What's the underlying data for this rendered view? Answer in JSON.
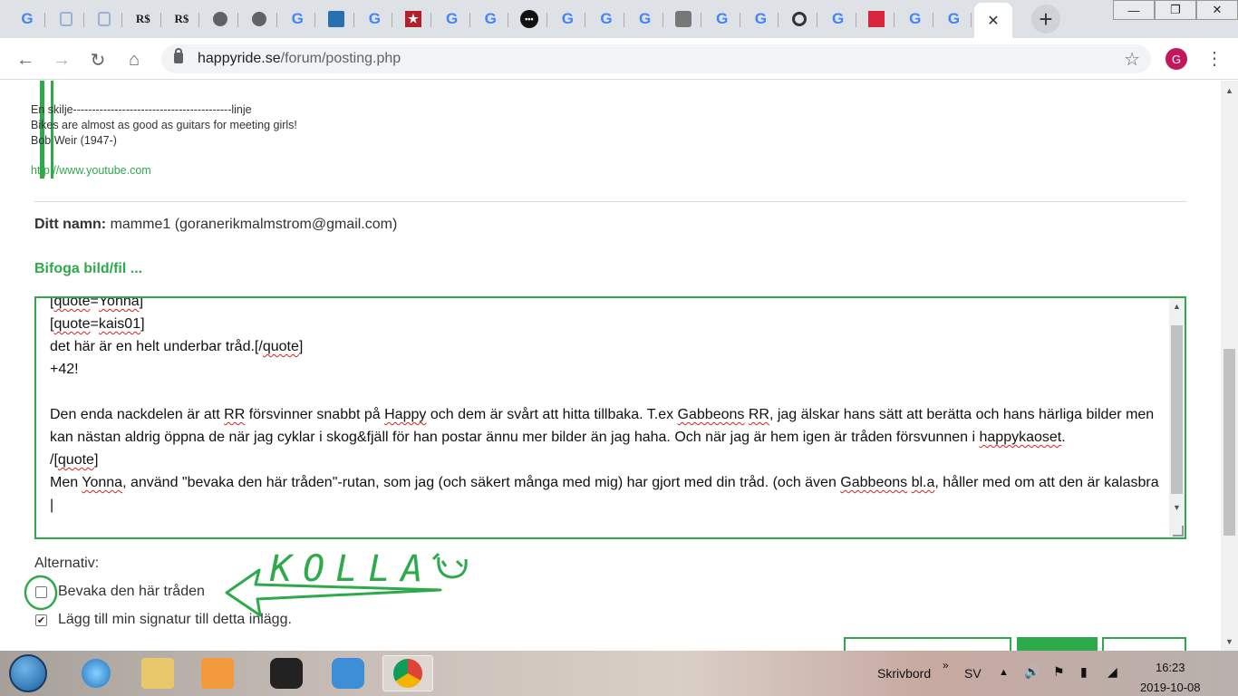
{
  "browser": {
    "tabs_count": 26,
    "new_tab_symbol": "+",
    "window_buttons": [
      "—",
      "❐",
      "✕"
    ],
    "url_host": "happyride.se",
    "url_path": "/forum/posting.php",
    "profile_initial": "G"
  },
  "signature": {
    "lines": [
      "En skilje------------------------------------------linje",
      "Bikes are almost as good as guitars for meeting girls!",
      "Bob Weir (1947-)"
    ],
    "link": "http://www.youtube.com"
  },
  "poster": {
    "label": "Ditt namn:",
    "value": "mamme1 (goranerikmalmstrom@gmail.com)"
  },
  "attach_label": "Bifoga bild/fil ...",
  "editor": {
    "paragraphs": [
      [
        {
          "t": "["
        },
        {
          "t": "quote",
          "sp": true
        },
        {
          "t": "="
        },
        {
          "t": "Yonna",
          "sp": true
        },
        {
          "t": "]"
        }
      ],
      [
        {
          "t": "["
        },
        {
          "t": "quote",
          "sp": true
        },
        {
          "t": "="
        },
        {
          "t": "kais01",
          "sp": true
        },
        {
          "t": "]"
        }
      ],
      [
        {
          "t": "det här är en helt underbar tråd.[/"
        },
        {
          "t": "quote",
          "sp": true
        },
        {
          "t": "]"
        }
      ],
      [
        {
          "t": "+42!"
        }
      ],
      [
        {
          "t": ""
        }
      ],
      [
        {
          "t": "Den enda nackdelen är att "
        },
        {
          "t": "RR",
          "sp": true
        },
        {
          "t": " försvinner snabbt på "
        },
        {
          "t": "Happy",
          "sp": true
        },
        {
          "t": " och dem är svårt att hitta tillbaka. T.ex "
        },
        {
          "t": "Gabbeons",
          "sp": true
        },
        {
          "t": " "
        },
        {
          "t": "RR",
          "sp": true
        },
        {
          "t": ", jag älskar hans sätt att berätta och hans härliga bilder men kan nästan aldrig öppna de när jag cyklar i skog&fjäll för han postar ännu mer bilder än jag haha. Och när jag är hem igen är tråden försvunnen i "
        },
        {
          "t": "happykaoset",
          "sp": true
        },
        {
          "t": "."
        }
      ],
      [
        {
          "t": "/["
        },
        {
          "t": "quote",
          "sp": true
        },
        {
          "t": "]"
        }
      ],
      [
        {
          "t": "Men "
        },
        {
          "t": "Yonna",
          "sp": true
        },
        {
          "t": ", använd \"bevaka den här tråden\"-rutan, som jag (och säkert många med mig) har gjort med din tråd. (och även "
        },
        {
          "t": "Gabbeons",
          "sp": true
        },
        {
          "t": " "
        },
        {
          "t": "bl.a",
          "sp": true
        },
        {
          "t": ", håller med om att den är kalasbra"
        },
        {
          "t": "​|"
        }
      ]
    ]
  },
  "options": {
    "label": "Alternativ:",
    "watch_topic": {
      "label": "Bevaka den här tråden",
      "checked": false
    },
    "attach_signature": {
      "label": "Lägg till min signatur till detta inlägg.",
      "checked": true
    }
  },
  "annotation": {
    "text": "KOLLA",
    "color": "#2eaa4b"
  },
  "taskbar": {
    "desktop_label": "Skrivbord",
    "language": "SV",
    "time": "16:23",
    "date": "2019-10-08"
  },
  "colors": {
    "accent_green": "#2eaa4b",
    "spell_red": "#d62222",
    "chrome_tabstrip": "#dee1e6"
  }
}
